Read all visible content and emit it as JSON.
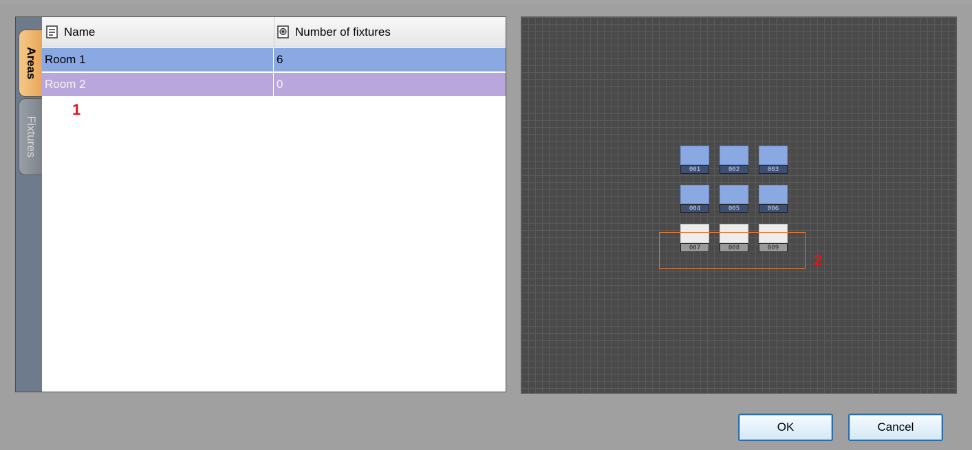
{
  "side_tabs": {
    "areas": "Areas",
    "fixtures": "Fixtures"
  },
  "table": {
    "headers": {
      "name": "Name",
      "count": "Number of fixtures"
    },
    "rows": [
      {
        "name": "Room 1",
        "count": "6"
      },
      {
        "name": "Room 2",
        "count": "0"
      }
    ]
  },
  "annotations": {
    "marker_1": "1",
    "marker_2": "2"
  },
  "fixtures": [
    {
      "label": "001",
      "state": "assigned"
    },
    {
      "label": "002",
      "state": "assigned"
    },
    {
      "label": "003",
      "state": "assigned"
    },
    {
      "label": "004",
      "state": "assigned"
    },
    {
      "label": "005",
      "state": "assigned"
    },
    {
      "label": "006",
      "state": "assigned"
    },
    {
      "label": "007",
      "state": "unassigned"
    },
    {
      "label": "008",
      "state": "unassigned"
    },
    {
      "label": "009",
      "state": "unassigned"
    }
  ],
  "colors": {
    "assigned": "#8aa8e2",
    "room2": "#b9a6dd",
    "selection": "#e07a35",
    "annotation": "#e41414"
  },
  "buttons": {
    "ok": "OK",
    "cancel": "Cancel"
  }
}
